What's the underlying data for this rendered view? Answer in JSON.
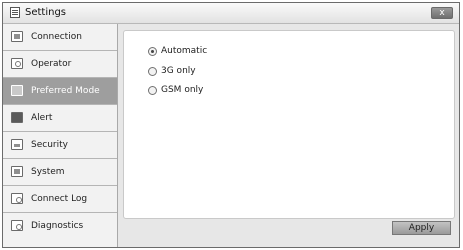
{
  "window": {
    "title": "Settings",
    "close_label": "x"
  },
  "sidebar": {
    "items": [
      {
        "label": "Connection",
        "icon": "connection-icon"
      },
      {
        "label": "Operator",
        "icon": "operator-icon"
      },
      {
        "label": "Preferred Mode",
        "icon": "preferred-mode-icon",
        "active": true
      },
      {
        "label": "Alert",
        "icon": "speaker-icon"
      },
      {
        "label": "Security",
        "icon": "lock-icon"
      },
      {
        "label": "System",
        "icon": "system-icon"
      },
      {
        "label": "Connect Log",
        "icon": "log-icon"
      },
      {
        "label": "Diagnostics",
        "icon": "diagnostics-icon"
      }
    ]
  },
  "preferred_mode": {
    "options": [
      {
        "label": "Automatic",
        "selected": true
      },
      {
        "label": "3G only",
        "selected": false
      },
      {
        "label": "GSM only",
        "selected": false
      }
    ]
  },
  "footer": {
    "apply_label": "Apply"
  },
  "colors": {
    "active_item": "#9e9e9e",
    "sidebar_bg": "#f2f2f2",
    "window_bg": "#e7e7e7"
  }
}
